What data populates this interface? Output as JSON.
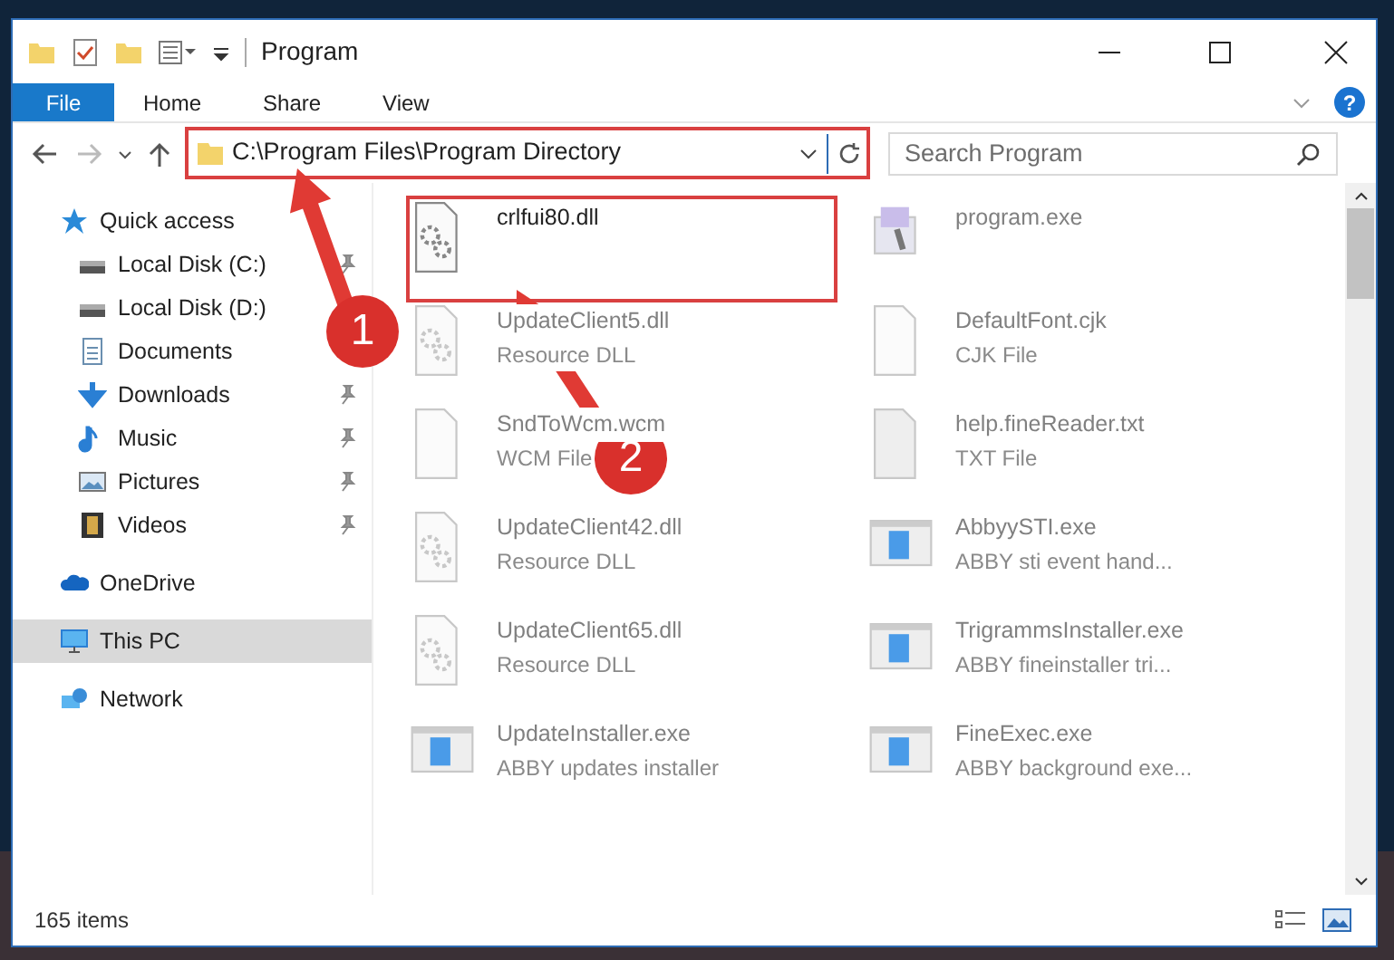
{
  "window": {
    "title": "Program"
  },
  "ribbon_tabs": [
    {
      "label": "File",
      "selected": true
    },
    {
      "label": "Home",
      "selected": false
    },
    {
      "label": "Share",
      "selected": false
    },
    {
      "label": "View",
      "selected": false
    }
  ],
  "help": {
    "label": "?"
  },
  "address": {
    "value": "C:\\Program Files\\Program Directory"
  },
  "search": {
    "placeholder": "Search Program"
  },
  "sidebar": {
    "items": [
      {
        "label": "Quick access",
        "selected": false,
        "children": [
          {
            "label": "Local Disk (C:)",
            "selected": false,
            "pinned": true
          },
          {
            "label": "Local Disk (D:)",
            "selected": false
          },
          {
            "label": "Documents",
            "selected": false
          },
          {
            "label": "Downloads",
            "selected": false,
            "pinned": true
          },
          {
            "label": "Music",
            "selected": false,
            "pinned": true
          },
          {
            "label": "Pictures",
            "selected": false,
            "pinned": true
          },
          {
            "label": "Videos",
            "selected": false,
            "pinned": true
          }
        ]
      },
      {
        "label": "OneDrive",
        "selected": false
      },
      {
        "label": "This PC",
        "selected": true
      },
      {
        "label": "Network",
        "selected": false
      }
    ]
  },
  "files": [
    {
      "name": "crlfui80.dll",
      "kind": "dll",
      "faded": false
    },
    {
      "name": "program.exe",
      "kind": "setup",
      "faded": true
    },
    {
      "name": "UpdateClient5.dll",
      "type": "Resource DLL",
      "kind": "dll",
      "faded": true
    },
    {
      "name": "DefaultFont.cjk",
      "type": "CJK File",
      "kind": "file",
      "faded": true
    },
    {
      "name": "SndToWcm.wcm",
      "type": "WCM File",
      "kind": "file",
      "faded": true
    },
    {
      "name": "help.fineReader.txt",
      "type": "TXT File",
      "kind": "txt",
      "faded": true
    },
    {
      "name": "UpdateClient42.dll",
      "type": "Resource DLL",
      "kind": "dll",
      "faded": true
    },
    {
      "name": "AbbyySTI.exe",
      "type": "ABBY sti event hand...",
      "kind": "app",
      "faded": true
    },
    {
      "name": "UpdateClient65.dll",
      "type": "Resource DLL",
      "kind": "dll",
      "faded": true
    },
    {
      "name": "TrigrammsInstaller.exe",
      "type": "ABBY fineinstaller tri...",
      "kind": "app",
      "faded": true
    },
    {
      "name": "UpdateInstaller.exe",
      "type": "ABBY updates installer",
      "kind": "app",
      "faded": true
    },
    {
      "name": "FineExec.exe",
      "type": "ABBY background exe...",
      "kind": "app",
      "faded": true
    }
  ],
  "status_bar": {
    "text": "165 items"
  },
  "annotations": [
    {
      "number": "1"
    },
    {
      "number": "2"
    }
  ]
}
